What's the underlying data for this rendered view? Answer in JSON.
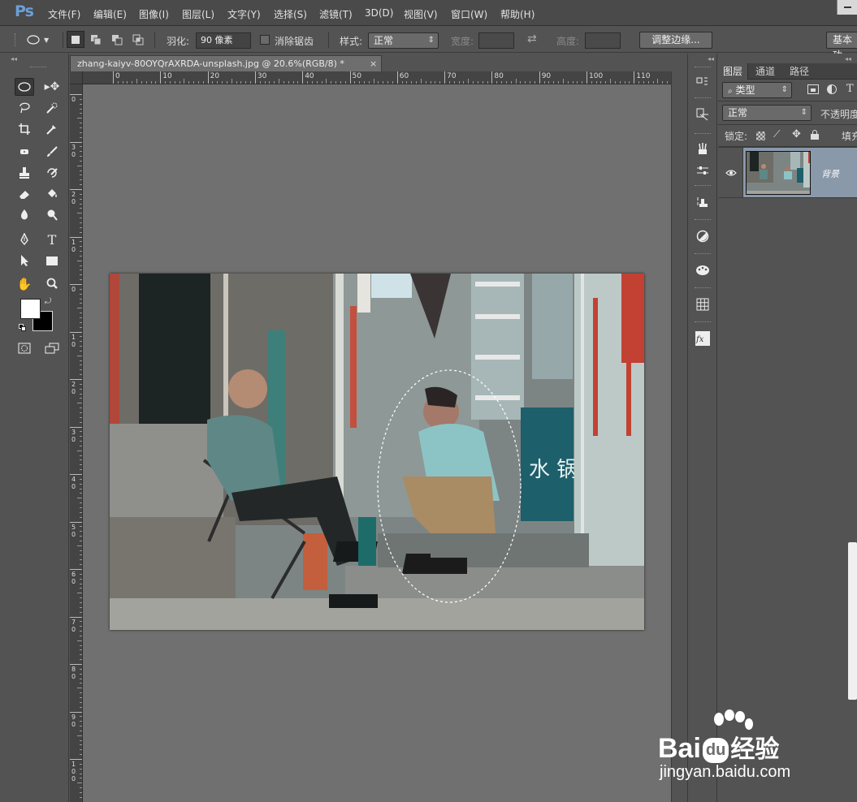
{
  "app": {
    "logo": "Ps"
  },
  "menu": [
    "文件(F)",
    "编辑(E)",
    "图像(I)",
    "图层(L)",
    "文字(Y)",
    "选择(S)",
    "滤镜(T)",
    "3D(D)",
    "视图(V)",
    "窗口(W)",
    "帮助(H)"
  ],
  "options": {
    "feather_label": "羽化:",
    "feather_value": "90 像素",
    "antialias_label": "消除锯齿",
    "style_label": "样式:",
    "style_value": "正常",
    "width_label": "宽度:",
    "height_label": "高度:",
    "refine_button": "调整边缘...",
    "workspace_button": "基本功"
  },
  "document": {
    "tab_title": "zhang-kaiyv-80OYQrAXRDA-unsplash.jpg @ 20.6%(RGB/8) *",
    "close_glyph": "×",
    "hruler_ticks": [
      "0",
      "10",
      "20",
      "30",
      "40",
      "50",
      "60",
      "70",
      "80",
      "90",
      "100",
      "110"
    ],
    "vruler_ticks": [
      "0",
      "3\n0",
      "2\n0",
      "1\n0",
      "0",
      "1\n0",
      "2\n0",
      "3\n0",
      "4\n0",
      "5\n0",
      "6\n0",
      "7\n0",
      "8\n0",
      "9\n0",
      "1\n0\n0"
    ]
  },
  "layers_panel": {
    "tabs": [
      "图层",
      "通道",
      "路径"
    ],
    "filter_kind": "类型",
    "blend_mode": "正常",
    "opacity_label": "不透明度",
    "lock_label": "锁定:",
    "fill_label": "填充",
    "layer_name": "背景"
  },
  "watermark": {
    "brand": "Bai",
    "brand2": "du",
    "cn": "经验",
    "url": "jingyan.baidu.com"
  },
  "colors": {
    "accent": "#6ba0d8",
    "layer_selected": "#8a99aa",
    "canvas": "#707070",
    "chrome": "#535353"
  },
  "icons": [
    "elliptical-marquee-icon",
    "move-icon",
    "lasso-icon",
    "quick-selection-icon",
    "crop-icon",
    "eyedropper-icon",
    "spot-healing-icon",
    "brush-icon",
    "clone-stamp-icon",
    "history-brush-icon",
    "eraser-icon",
    "paint-bucket-icon",
    "blur-icon",
    "dodge-icon",
    "pen-icon",
    "type-icon",
    "path-selection-icon",
    "rectangle-icon",
    "hand-icon",
    "zoom-icon",
    "eye-icon"
  ]
}
